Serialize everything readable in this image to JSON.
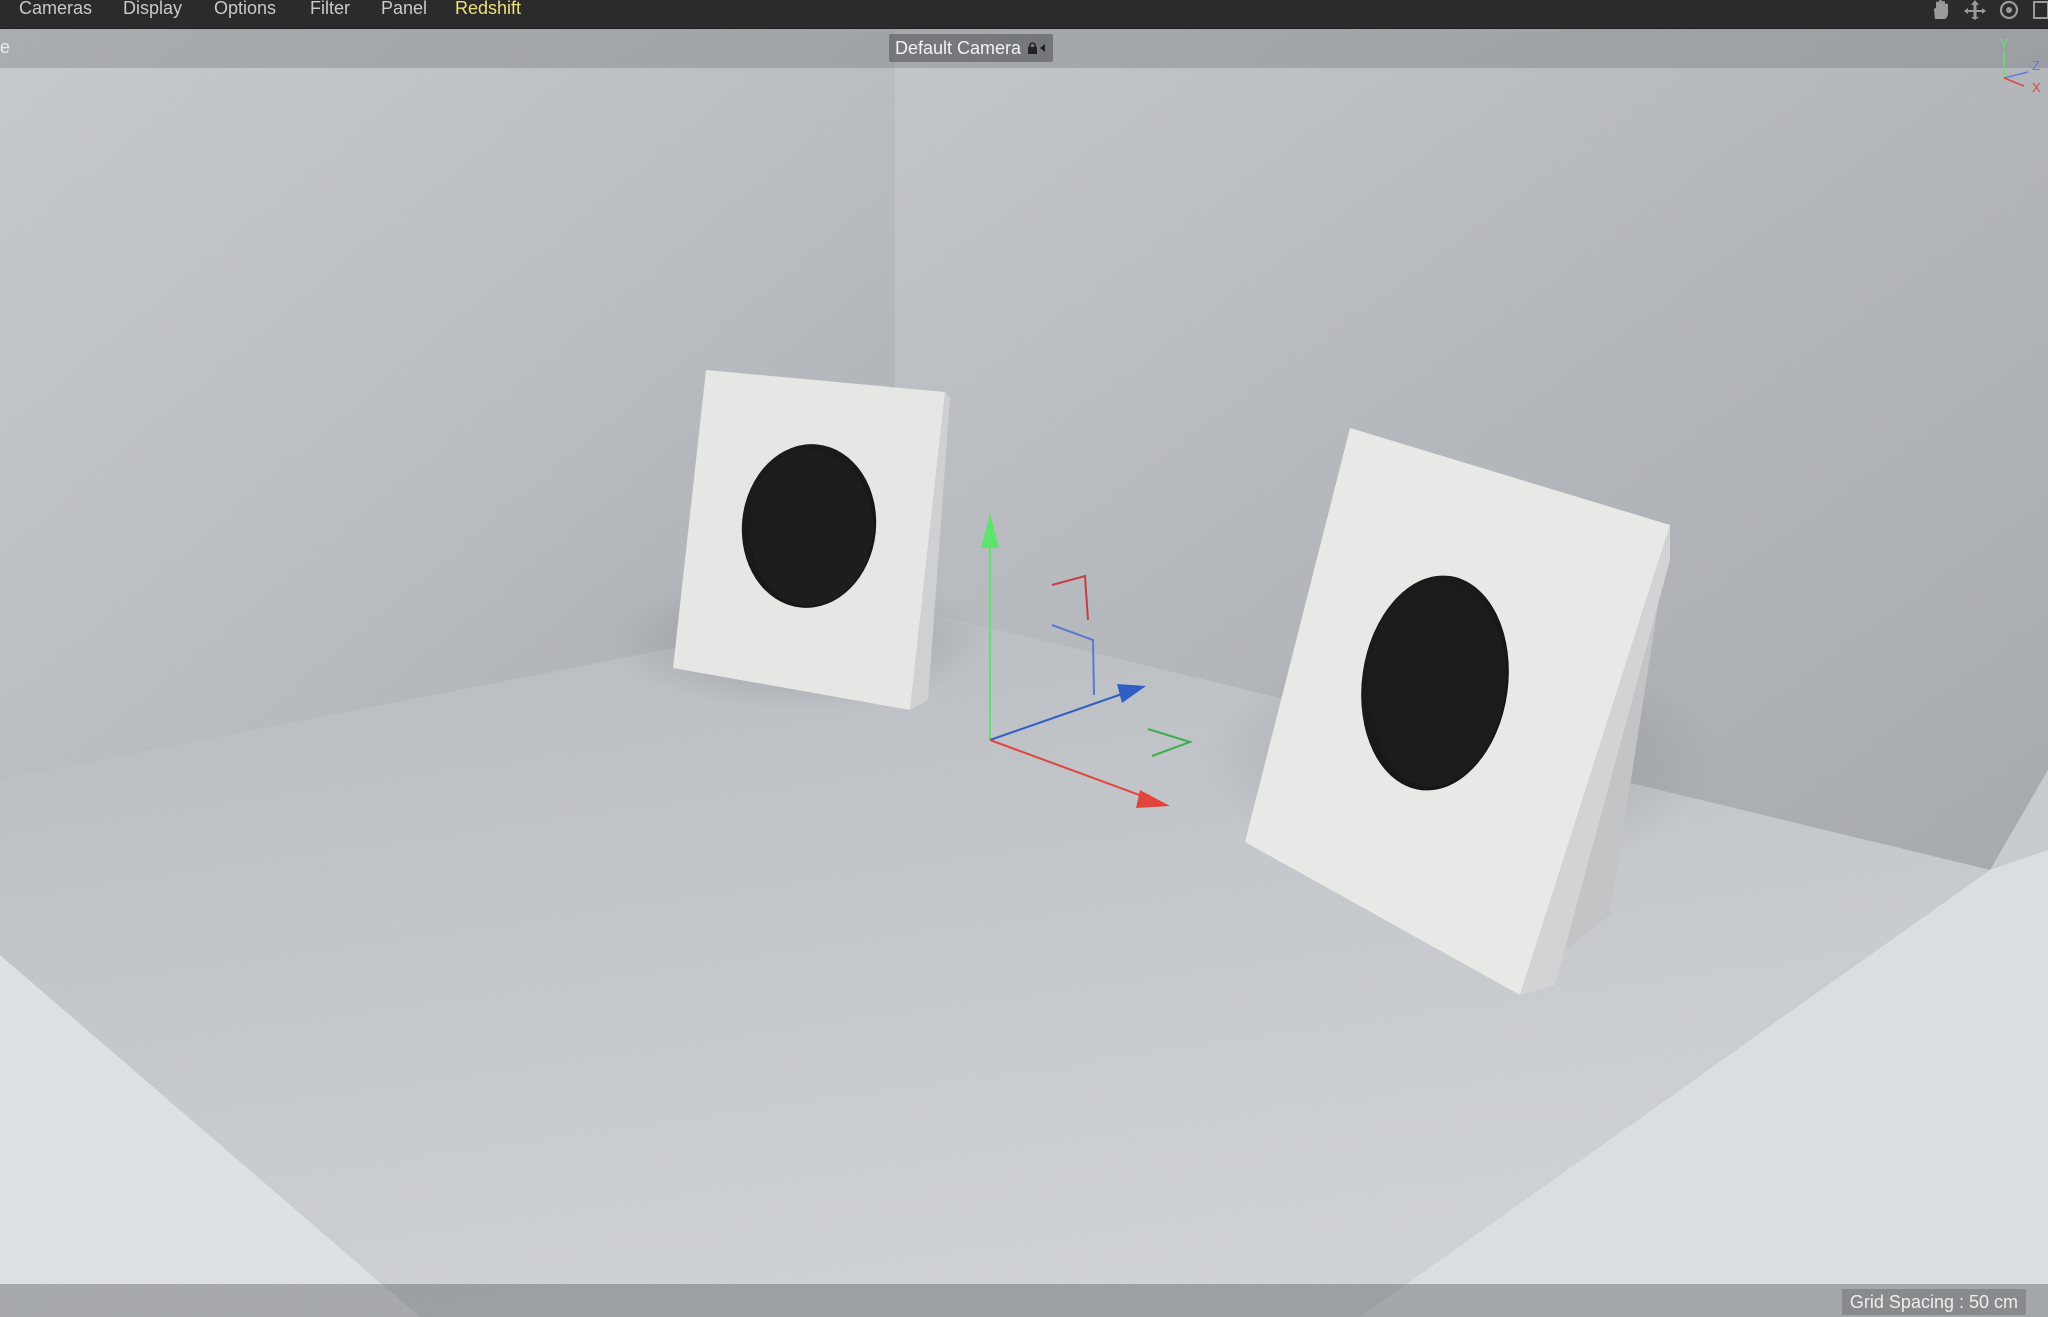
{
  "menu": {
    "items": [
      {
        "label": "Cameras"
      },
      {
        "label": "Display"
      },
      {
        "label": "Options"
      },
      {
        "label": "Filter"
      },
      {
        "label": "Panel"
      },
      {
        "label": "Redshift"
      }
    ],
    "accent_color": "#ede27a"
  },
  "toolbar": {
    "icons": [
      "hand-pan-icon",
      "move-icon",
      "rotate-icon",
      "maximize-icon"
    ]
  },
  "viewport": {
    "left_label": "re",
    "camera_name": "Default Camera",
    "orientation_axes": {
      "y": "Y",
      "z": "Z",
      "x": "X"
    },
    "grid_spacing": "Grid Spacing : 50 cm"
  },
  "colors": {
    "axis_x": "#e2453e",
    "axis_y": "#5fe36f",
    "axis_z": "#2f5fc4"
  }
}
